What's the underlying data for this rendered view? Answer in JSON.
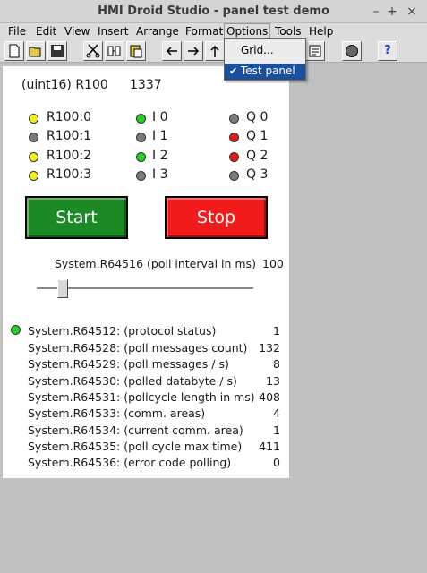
{
  "window": {
    "title": "HMI Droid Studio - panel test demo",
    "controls": [
      "–",
      "+",
      "×"
    ]
  },
  "menu": [
    "File",
    "Edit",
    "View",
    "Insert",
    "Arrange",
    "Format",
    "Options",
    "Tools",
    "Help"
  ],
  "options_menu": {
    "items": [
      {
        "label": "Grid...",
        "checked": false
      },
      {
        "label": "Test panel",
        "checked": true
      }
    ]
  },
  "toolbar": {
    "buttons": [
      "new-icon",
      "open-icon",
      "save-icon",
      "cut-icon",
      "copy-icon",
      "paste-icon",
      "arrow-left-icon",
      "arrow-right-icon",
      "arrow-up-icon",
      "properties-icon",
      "circle-icon",
      "help-icon"
    ],
    "help_label": "?"
  },
  "panel": {
    "register_label": "(uint16) R100",
    "register_value": "1337",
    "indicators": [
      {
        "label": "R100:0",
        "color": "#f4ef22"
      },
      {
        "label": "R100:1",
        "color": "#7a7a7a"
      },
      {
        "label": "R100:2",
        "color": "#f4ef22"
      },
      {
        "label": "R100:3",
        "color": "#f4ef22"
      },
      {
        "label": "I 0",
        "color": "#22d022"
      },
      {
        "label": "I 1",
        "color": "#7a7a7a"
      },
      {
        "label": "I 2",
        "color": "#22d022"
      },
      {
        "label": "I 3",
        "color": "#7a7a7a"
      },
      {
        "label": "Q 0",
        "color": "#7a7a7a"
      },
      {
        "label": "Q 1",
        "color": "#e11919"
      },
      {
        "label": "Q 2",
        "color": "#e11919"
      },
      {
        "label": "Q 3",
        "color": "#7a7a7a"
      }
    ],
    "start_label": "Start",
    "start_color": "#1c8a24",
    "stop_label": "Stop",
    "stop_color": "#f21b1b",
    "poll_label": "System.R64516 (poll interval in ms)",
    "poll_value": "100",
    "status_led_color": "#22d022",
    "stats": [
      {
        "label": "System.R64512: (protocol status)",
        "value": "1"
      },
      {
        "label": "System.R64528: (poll messages count)",
        "value": "132"
      },
      {
        "label": "System.R64529: (poll messages / s)",
        "value": "8"
      },
      {
        "label": "System.R64530: (polled databyte / s)",
        "value": "13"
      },
      {
        "label": "System.R64531: (pollcycle length in ms)",
        "value": "408"
      },
      {
        "label": "System.R64533: (comm. areas)",
        "value": "4"
      },
      {
        "label": "System.R64534: (current comm. area)",
        "value": "1"
      },
      {
        "label": "System.R64535: (poll cycle max time)",
        "value": "411"
      },
      {
        "label": "System.R64536: (error code polling)",
        "value": "0"
      }
    ]
  }
}
